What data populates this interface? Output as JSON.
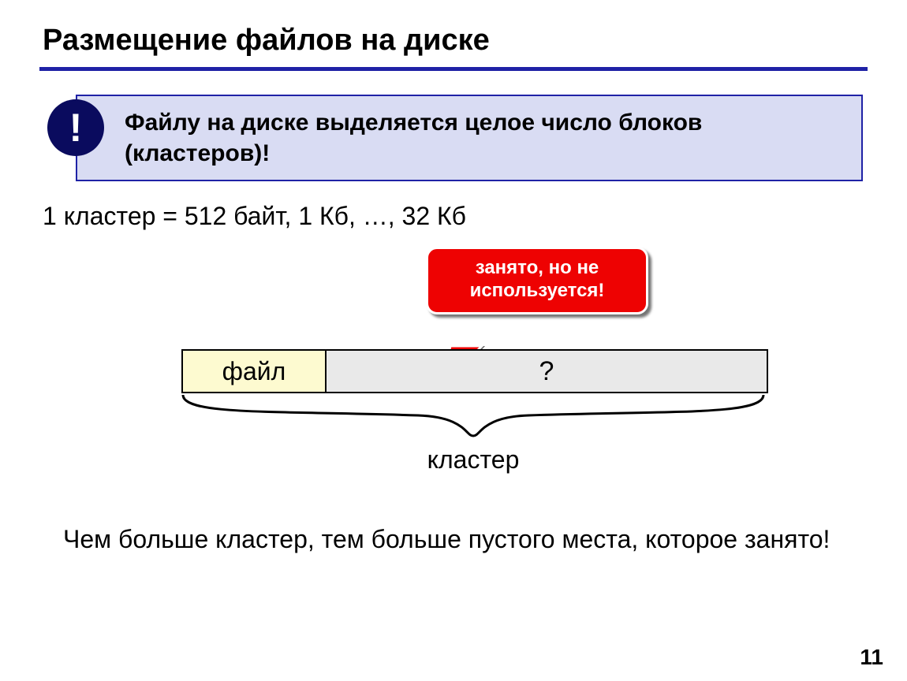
{
  "title": "Размещение файлов на диске",
  "bang": "!",
  "callout": "Файлу на диске выделяется целое число блоков (кластеров)!",
  "body1": "1 кластер = 512 байт, 1 Кб, …, 32 Кб",
  "bubble_line1": "занято, но не",
  "bubble_line2": "используется!",
  "bar_file": "файл",
  "bar_rest": "?",
  "cluster_label": "кластер",
  "body2": "Чем больше кластер, тем больше пустого места, которое занято!",
  "page_number": "11"
}
